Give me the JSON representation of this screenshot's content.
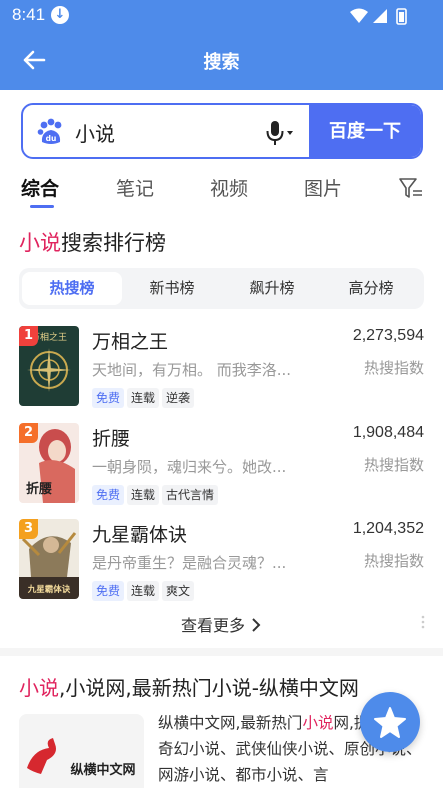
{
  "status_bar": {
    "time": "8:41",
    "download_icon": "download-icon"
  },
  "header": {
    "title": "搜索",
    "back_icon": "arrow-left-icon"
  },
  "search": {
    "query": "小说",
    "button_label": "百度一下",
    "logo_icon": "baidu-du-icon",
    "mic_icon": "microphone-icon"
  },
  "tabs": [
    {
      "label": "综合",
      "active": true
    },
    {
      "label": "笔记"
    },
    {
      "label": "视频"
    },
    {
      "label": "图片"
    }
  ],
  "ranking": {
    "title_highlight": "小说",
    "title_rest": "搜索排行榜",
    "segments": [
      "热搜榜",
      "新书榜",
      "飙升榜",
      "高分榜"
    ],
    "active_segment": 0,
    "items": [
      {
        "rank": "1",
        "title": "万相之王",
        "desc": "天地间，有万相。 而我李洛...",
        "tags": [
          "免费",
          "连载",
          "逆袭"
        ],
        "count": "2,273,594",
        "metric": "热搜指数",
        "cover_text": "万相之王"
      },
      {
        "rank": "2",
        "title": "折腰",
        "desc": "一朝身陨，魂归来兮。她改...",
        "tags": [
          "免费",
          "连载",
          "古代言情"
        ],
        "count": "1,908,484",
        "metric": "热搜指数",
        "cover_text": "折腰"
      },
      {
        "rank": "3",
        "title": "九星霸体诀",
        "desc": "是丹帝重生？是融合灵魂？...",
        "tags": [
          "免费",
          "连载",
          "爽文"
        ],
        "count": "1,204,352",
        "metric": "热搜指数",
        "cover_text": "九星霸体诀"
      }
    ],
    "more_label": "查看更多"
  },
  "result": {
    "title_hl": "小说",
    "title_rest": ",小说网,最新热门小说-纵横中文网",
    "thumb_text": "纵横中文网",
    "desc_pre": "纵横中文网,最新热门",
    "desc_hl": "小说",
    "desc_post": "网,提供玄幻奇幻小说、武侠仙侠小说、原创小说、网游小说、都市小说、言"
  },
  "colors": {
    "primary": "#4e8bea",
    "accent": "#4e6ef2",
    "highlight": "#e0245e"
  }
}
